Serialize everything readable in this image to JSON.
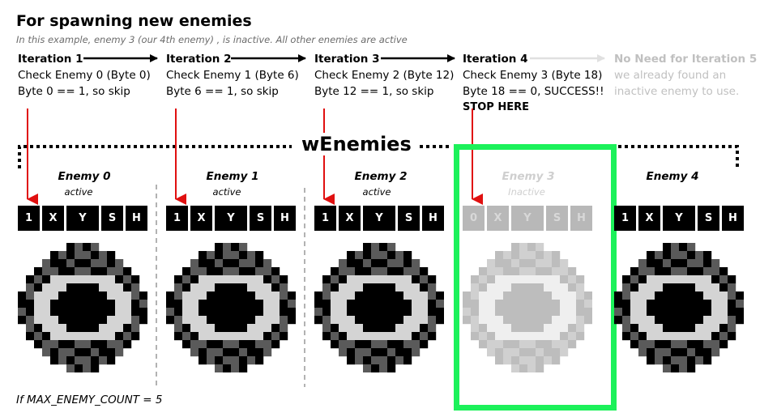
{
  "title": "For spawning new enemies",
  "subtitle": "In this example, enemy 3 (our 4th enemy) , is inactive. All other enemies are active",
  "iterations": [
    {
      "heading": "Iteration 1",
      "line1": "Check Enemy 0 (Byte 0)",
      "line2": "Byte 0 == 1, so skip",
      "line3": ""
    },
    {
      "heading": "Iteration 2",
      "line1": "Check Enemy 1 (Byte 6)",
      "line2": "Byte 6 == 1, so skip",
      "line3": ""
    },
    {
      "heading": "Iteration 3",
      "line1": "Check Enemy 2 (Byte 12)",
      "line2": "Byte 12 == 1, so skip",
      "line3": ""
    },
    {
      "heading": "Iteration 4",
      "line1": "Check Enemy 3 (Byte 18)",
      "line2": "Byte 18 == 0, SUCCESS!!",
      "line3": "STOP HERE"
    },
    {
      "heading": "No Need for Iteration 5",
      "line1": "we already found an",
      "line2": "inactive enemy to use.",
      "line3": ""
    }
  ],
  "array_label": "wEnemies",
  "enemies": [
    {
      "name": "Enemy 0",
      "state": "active",
      "bytes": [
        "1",
        "X",
        "Y",
        "S",
        "H"
      ]
    },
    {
      "name": "Enemy 1",
      "state": "active",
      "bytes": [
        "1",
        "X",
        "Y",
        "S",
        "H"
      ]
    },
    {
      "name": "Enemy 2",
      "state": "active",
      "bytes": [
        "1",
        "X",
        "Y",
        "S",
        "H"
      ]
    },
    {
      "name": "Enemy 3",
      "state": "Inactive",
      "bytes": [
        "0",
        "X",
        "Y",
        "S",
        "H"
      ]
    },
    {
      "name": "Enemy 4",
      "state": "",
      "bytes": [
        "1",
        "X",
        "Y",
        "S",
        "H"
      ]
    }
  ],
  "footer": "If MAX_ENEMY_COUNT = 5",
  "colors": {
    "highlight": "#1cf15a",
    "pointer": "#e01010",
    "inactive_text": "#cfcfcf"
  }
}
